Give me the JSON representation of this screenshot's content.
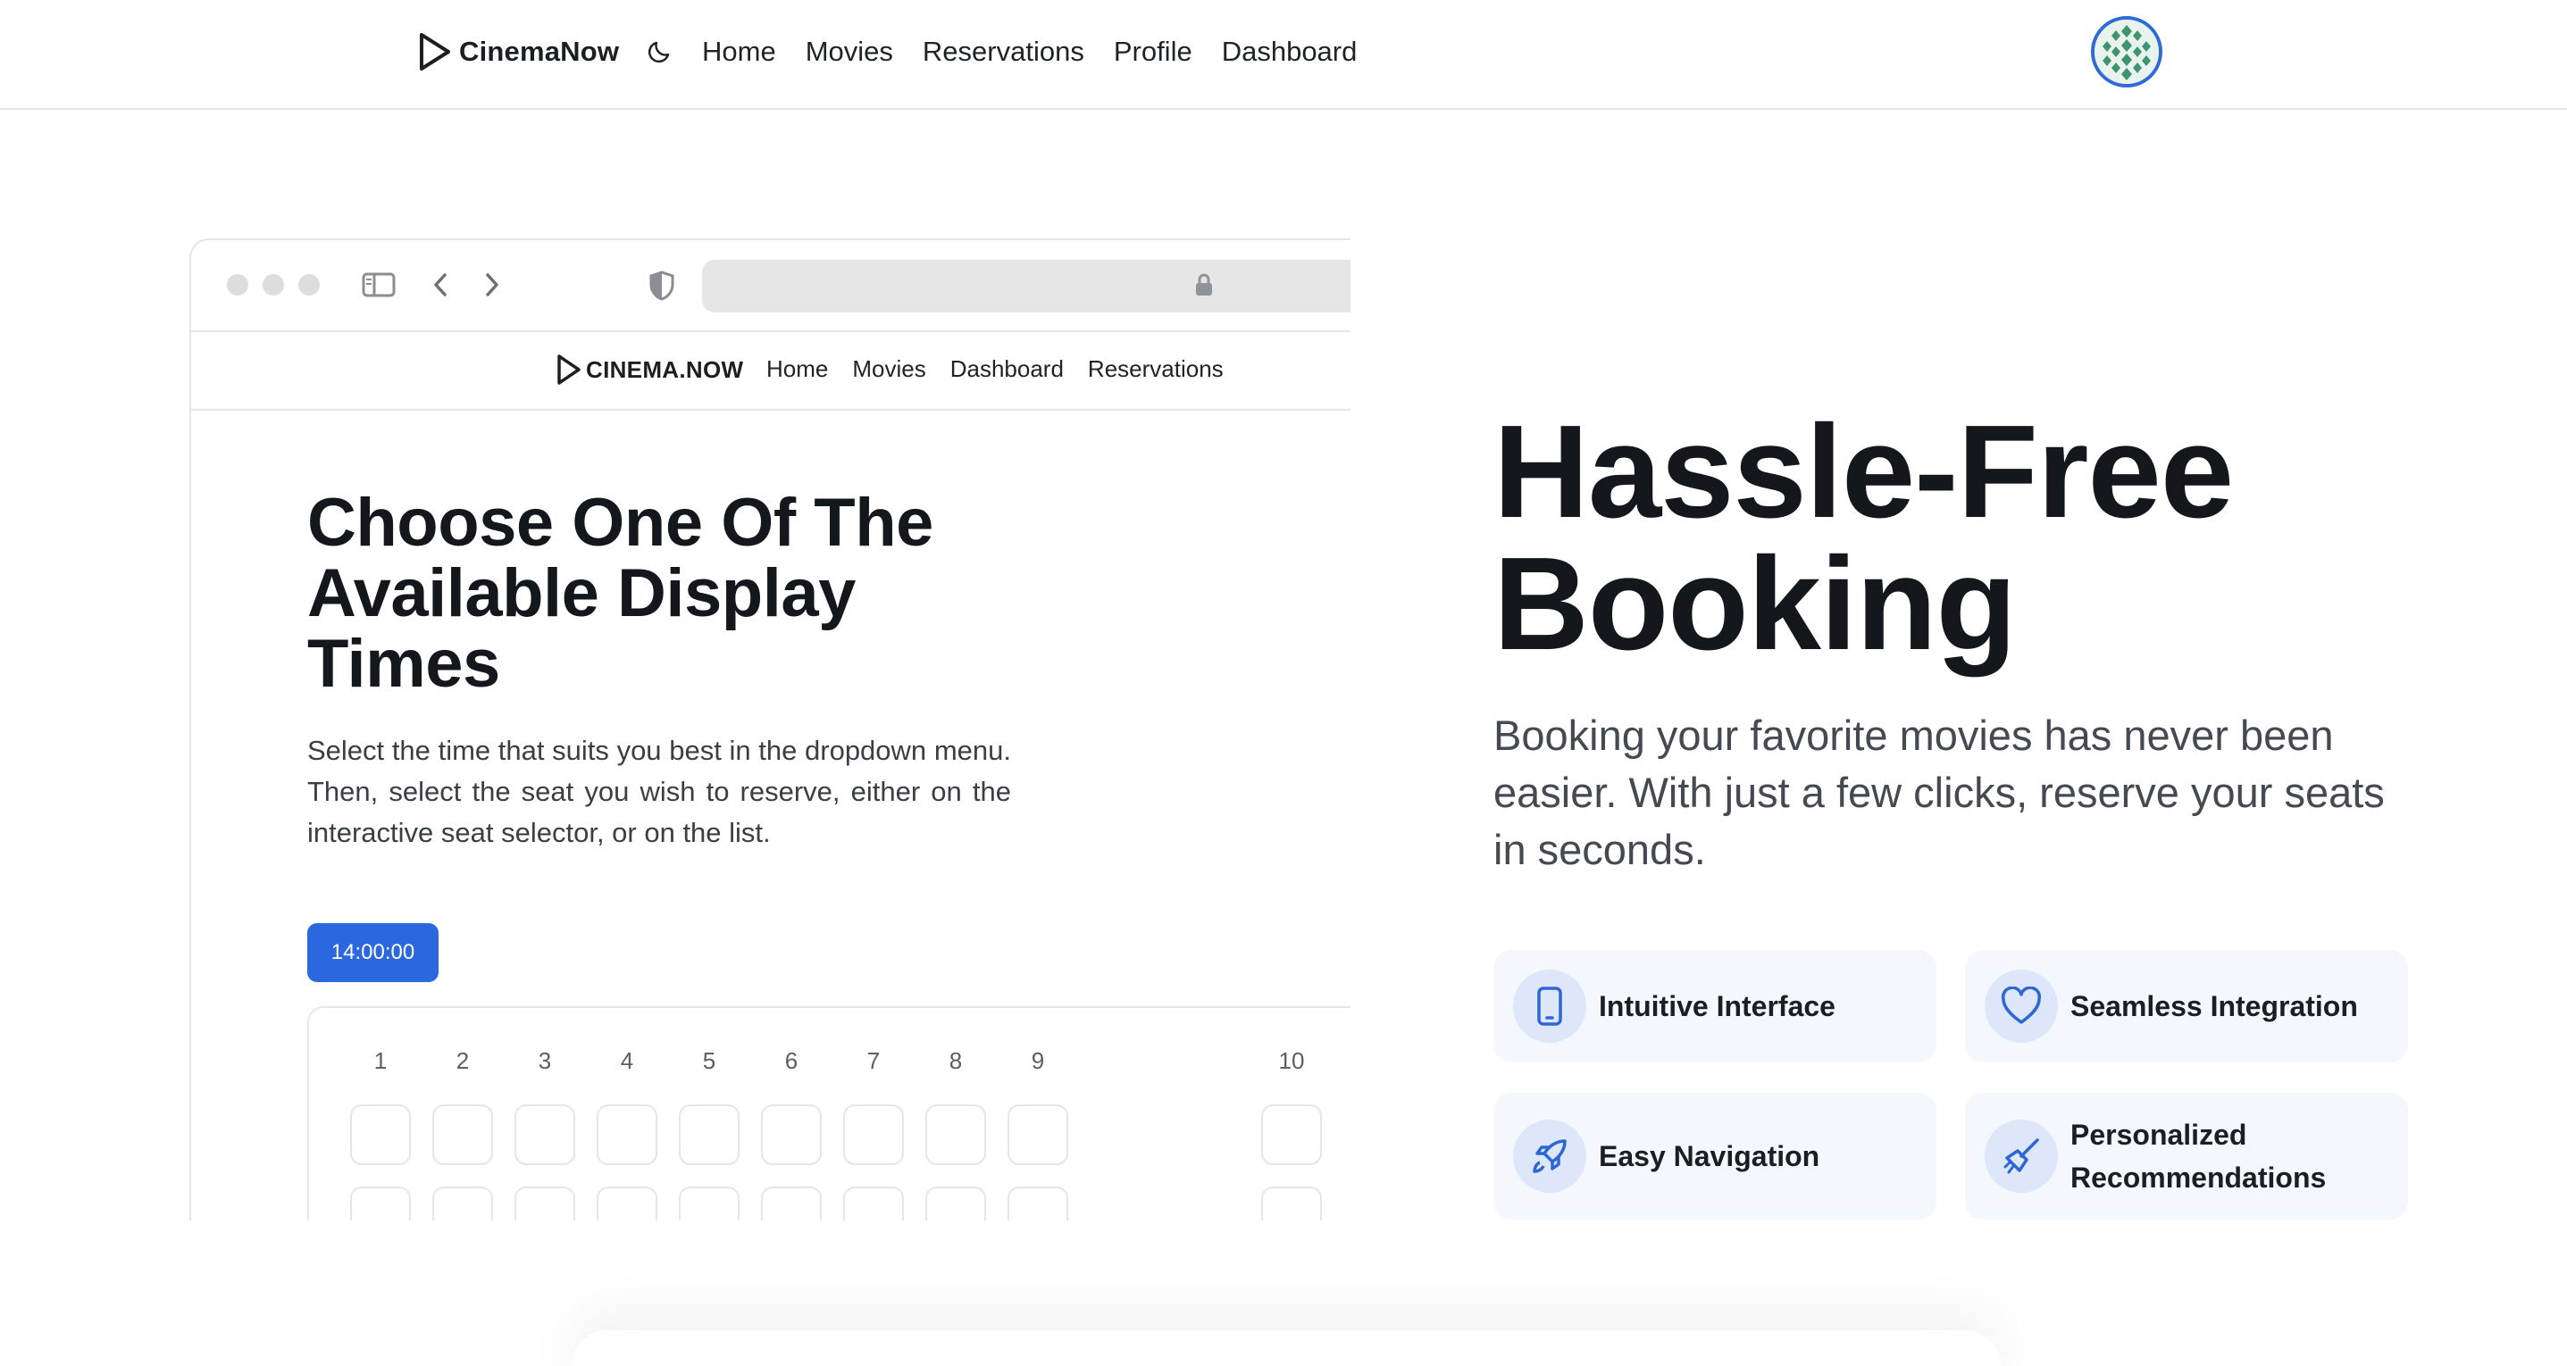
{
  "navbar": {
    "brand": "CinemaNow",
    "links": [
      "Home",
      "Movies",
      "Reservations",
      "Profile",
      "Dashboard"
    ]
  },
  "mockup": {
    "nav": {
      "brand": "CINEMA.NOW",
      "links": [
        "Home",
        "Movies",
        "Dashboard",
        "Reservations"
      ]
    },
    "title": "Choose One Of The Available Display Times",
    "description": "Select the time that suits you best in the dropdown menu. Then, select the seat you wish to reserve, either on the interactive seat selector, or on the list.",
    "time_button": "14:00:00",
    "seat_columns": [
      "1",
      "2",
      "3",
      "4",
      "5",
      "6",
      "7",
      "8",
      "9",
      "10"
    ]
  },
  "hero": {
    "title_line1": "Hassle-Free",
    "title_line2": "Booking",
    "subtitle": "Booking your favorite movies has never been easier. With just a few clicks, reserve your seats in seconds."
  },
  "features": [
    {
      "label": "Intuitive Interface",
      "icon": "tablet-icon"
    },
    {
      "label": "Seamless Integration",
      "icon": "heart-icon"
    },
    {
      "label": "Easy Navigation",
      "icon": "rocket-icon"
    },
    {
      "label": "Personalized Recommendations",
      "icon": "paintbrush-icon"
    }
  ],
  "colors": {
    "accent": "#2b68e0",
    "feature_bg": "#f4f7fc",
    "icon_bg": "#dde7f9",
    "icon_stroke": "#2f66d6"
  }
}
